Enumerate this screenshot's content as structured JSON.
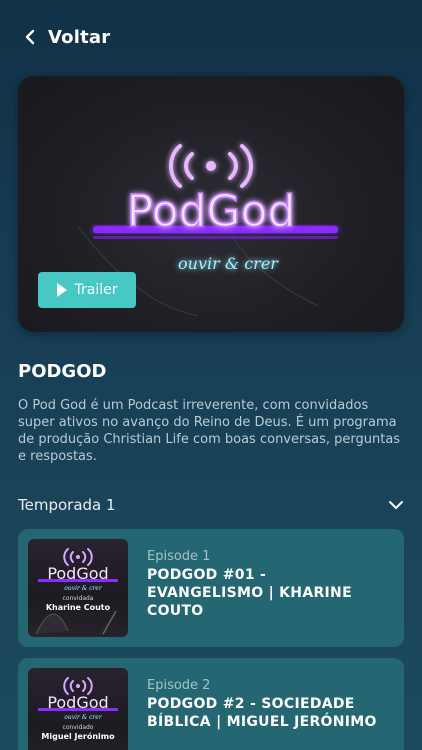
{
  "header": {
    "back_label": "Voltar"
  },
  "hero": {
    "logo_text": "PodGod",
    "tagline": "ouvir & crer",
    "trailer_label": "Trailer"
  },
  "podcast": {
    "title": "PODGOD",
    "description": "O Pod God é um Podcast irreverente, com convidados super ativos no avanço do Reino de Deus. É um programa de produção Christian Life com boas conversas, perguntas e respostas."
  },
  "season": {
    "label": "Temporada 1"
  },
  "episodes": [
    {
      "number": "Episode 1",
      "title": "PODGOD #01 - EVANGELISMO | KHARINE COUTO",
      "thumb_logo": "PodGod",
      "thumb_tagline": "ouvir & crer",
      "thumb_tag": "convidada",
      "thumb_guest": "Kharine Couto"
    },
    {
      "number": "Episode 2",
      "title": "PODGOD #2 - SOCIEDADE BÍBLICA | MIGUEL JERÓNIMO",
      "thumb_logo": "PodGod",
      "thumb_tagline": "ouvir & crer",
      "thumb_tag": "convidado",
      "thumb_guest": "Miguel Jerónimo"
    }
  ],
  "colors": {
    "accent": "#48c8c5",
    "card": "#246672",
    "neon_purple": "#a64dff",
    "neon_cyan": "#5fe8ff"
  },
  "icons": {
    "back": "chevron-left-icon",
    "play": "play-icon",
    "expand": "chevron-down-icon",
    "broadcast": "broadcast-icon"
  }
}
